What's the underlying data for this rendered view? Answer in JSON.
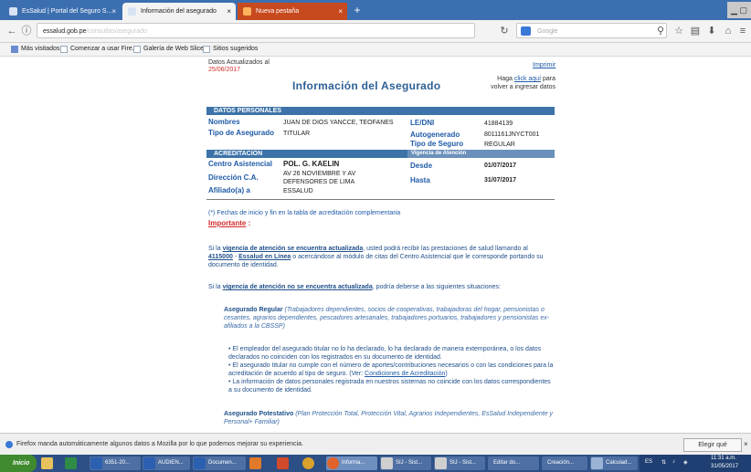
{
  "browser": {
    "tabs": [
      {
        "label": "EsSalud | Portal del Seguro S...",
        "close": "×"
      },
      {
        "label": "Información del asegurado",
        "close": "×"
      },
      {
        "label": "Nueva pestaña",
        "close": "×"
      }
    ],
    "new_tab": "+",
    "url": "essalud.gob.pe",
    "url_ghost": "/consultas/asegurado",
    "search_placeholder": "Google",
    "bookmarks": [
      "Más visitados",
      "Comenzar a usar Fire...",
      "Galería de Web Slice",
      "Sitios sugeridos"
    ],
    "window_ctl": "▁ ▢"
  },
  "page": {
    "data_date_label": "Datos Actualizados al",
    "data_date": "25/06/2017",
    "print_link": "Imprimir",
    "back_note_pre": "Haga ",
    "back_note_link": "click aquí",
    "back_note_post": " para volver a ingresar datos",
    "title": "Información del Asegurado",
    "sec_personal": "DATOS PERSONALES",
    "nombres_label": "Nombres",
    "nombres_value": "JUAN DE DIOS YANCCE, TEOFANES",
    "tipo_asegurado_label": "Tipo de Asegurado",
    "tipo_asegurado_value": "TITULAR",
    "dni_label": "LE/DNI",
    "dni_value": "41884139",
    "autogenerado_label": "Autogenerado",
    "autogenerado_value": "8011161JNYCT001",
    "tipo_seguro_label": "Tipo de Seguro",
    "tipo_seguro_value": "REGULAR",
    "sec_acreditacion": "ACREDITACION",
    "sec_vigencia": "Vigencia de Atención",
    "centro_label": "Centro Asistencial",
    "centro_value": "POL. G. KAELIN",
    "direccion_label": "Dirección C.A.",
    "direccion_value_1": "AV 26 NOVIEMBRE Y AV",
    "direccion_value_2": "DEFENSORES DE LIMA",
    "afiliado_label": "Afiliado(a) a",
    "afiliado_value": "ESSALUD",
    "desde_label": "Desde",
    "desde_value": "01/07/2017",
    "hasta_label": "Hasta",
    "hasta_value": "31/07/2017",
    "note_star": "(*)",
    "note_text": "Fechas de inicio y fin en la tabla de acreditación complementaria",
    "importante": "Importante",
    "importante_colon": " :",
    "p1_a": "Si la ",
    "p1_b": "vigencia de atención se encuentra actualizada",
    "p1_c": ", usted podrá recibir las prestaciones de salud llamando al ",
    "p1_d": "4115000",
    "p1_e": " - ",
    "p1_f": "Essalud en Línea",
    "p1_g": " o acercándose al módulo de citas del Centro Asistencial que le corresponde portando su documento de identidad.",
    "p2_a": "Si la ",
    "p2_b": "vigencia de atención no se encuentra actualizada",
    "p2_c": ", podría deberse a las siguientes situaciones:",
    "reg_title": "Asegurado Regular",
    "reg_desc": " (Trabajadores dependientes, socios de cooperativas, trabajadoras del hogar, pensionistas o cesantes, agrarios dependientes, pescadores artesanales, trabajadores portuarios, trabajadores y pensionistas ex-afiliados a la CBSSP)",
    "bullet1": "• El empleador del asegurado titular no lo ha declarado, lo ha declarado de manera extemporánea, o los datos declarados no coinciden con los registrados en su documento de identidad.",
    "bullet2_a": "• El asegurado titular no cumple con el número de aportes/contribuciones necesarios o con las condiciones para la acreditación de acuerdo al tipo de seguro. (Ver: ",
    "bullet2_link": "Condiciones de Acreditación",
    "bullet2_b": ")",
    "bullet3": "• La información de datos personales registrada en nuestros sistemas no coincide con los datos correspondientes a su documento de identidad.",
    "pot_title": "Asegurado Potestativo",
    "pot_desc": " (Plan Protección Total, Protección Vital, Agrarios Independientes, EsSalud Independiente y Personal+ Familiar)"
  },
  "notification": {
    "text": "Firefox manda automáticamente algunos datos a Mozilla por lo que podemos mejorar su experiencia.",
    "share_button": "Elegir qué comparto",
    "close": "×"
  },
  "taskbar": {
    "start": "Inicio",
    "items": [
      "6351-20...",
      "AUDIEN...",
      "Documen...",
      "Informa...",
      "SIJ - Sist...",
      "SIJ - Sist...",
      "Editar do...",
      "Creación...",
      "Calculad..."
    ],
    "lang": "ES",
    "time": "11:31 a.m.",
    "date": "31/05/2017"
  },
  "colors": {
    "accent": "#2d5f94",
    "section_bar": "#3d73a8",
    "important": "#d42a2a",
    "taskbar": "#2c4f86"
  }
}
